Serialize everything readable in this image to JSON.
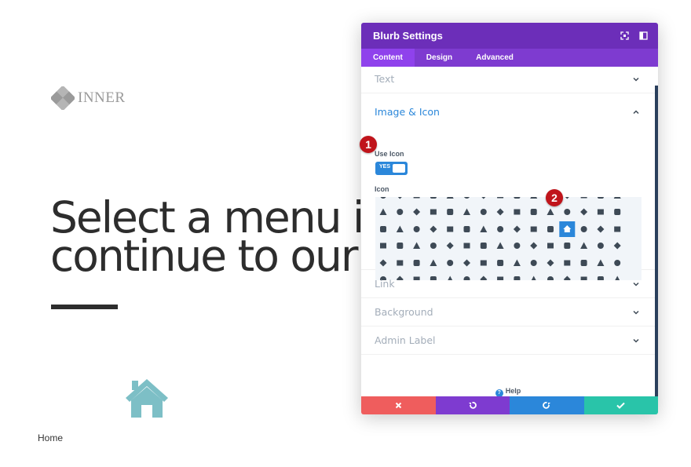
{
  "page": {
    "logo_text": "INNER",
    "hero_line_1": "Select a menu it",
    "hero_line_2": "continue to our v",
    "home_label": "Home",
    "home_icon": "home-icon",
    "home_icon_color": "#7dbfc6"
  },
  "modal": {
    "title": "Blurb Settings",
    "header_icons": [
      "fullscreen-icon",
      "sidebar-icon"
    ],
    "tabs": [
      {
        "label": "Content",
        "active": true
      },
      {
        "label": "Design",
        "active": false
      },
      {
        "label": "Advanced",
        "active": false
      }
    ],
    "sections": {
      "text": "Text",
      "image_icon": "Image & Icon",
      "link": "Link",
      "background": "Background",
      "admin_label": "Admin Label"
    },
    "use_icon_label": "Use Icon",
    "use_icon_value": "YES",
    "icon_label": "Icon",
    "selected_icon": "home-icon",
    "help": "Help",
    "markers": [
      "1",
      "2"
    ],
    "footer_buttons": [
      {
        "name": "discard",
        "icon": "close-icon",
        "color": "#ef5d5d"
      },
      {
        "name": "undo",
        "icon": "undo-icon",
        "color": "#7e3bd0"
      },
      {
        "name": "redo",
        "icon": "redo-icon",
        "color": "#2b87da"
      },
      {
        "name": "save",
        "icon": "check-icon",
        "color": "#29c4a9"
      }
    ],
    "colors": {
      "header": "#6c2eb9",
      "tabs": "#7e3bd0",
      "accent": "#2b87da",
      "marker": "#c0141b"
    }
  }
}
